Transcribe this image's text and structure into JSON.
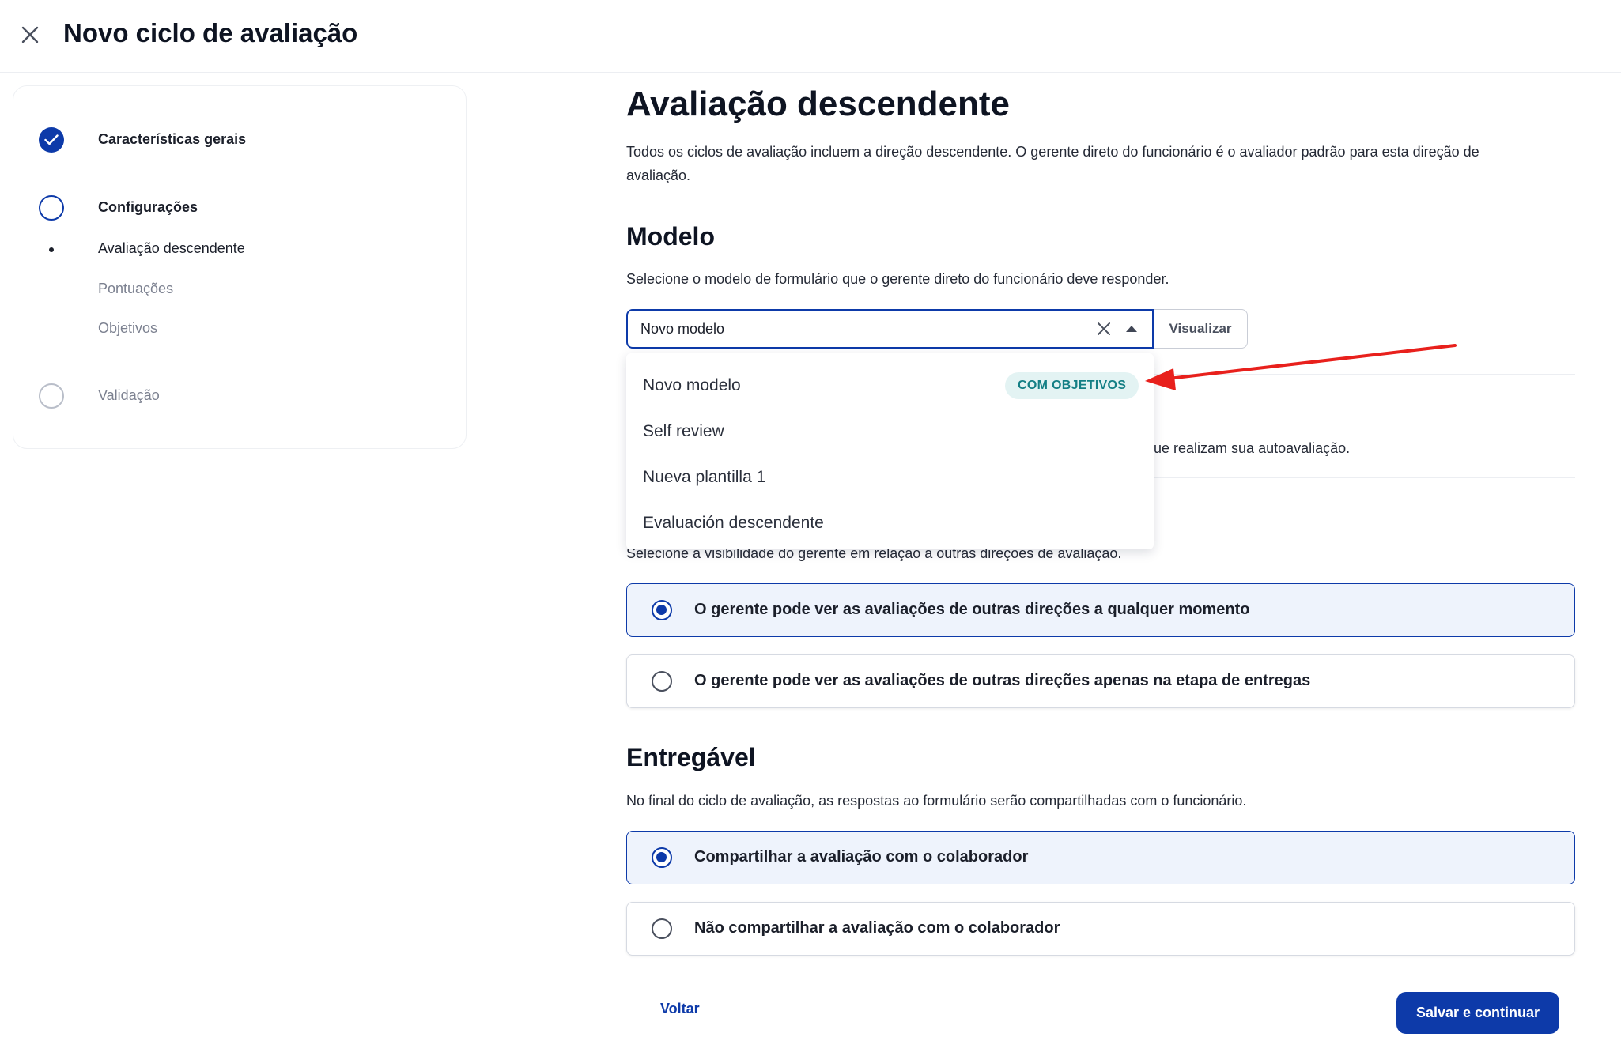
{
  "header": {
    "title": "Novo ciclo de avaliação",
    "close_icon": "close-icon"
  },
  "stepper": {
    "steps": [
      {
        "label": "Características gerais",
        "status": "done"
      },
      {
        "label": "Configurações",
        "status": "current"
      },
      {
        "label": "Avaliação descendente",
        "status": "sub-current"
      },
      {
        "label": "Pontuações",
        "status": "sub-pending"
      },
      {
        "label": "Objetivos",
        "status": "sub-pending"
      },
      {
        "label": "Validação",
        "status": "pending"
      }
    ]
  },
  "main": {
    "title": "Avaliação descendente",
    "description": "Todos os ciclos de avaliação incluem a direção descendente. O gerente direto do funcionário é o avaliador padrão para esta direção de avaliação.",
    "modelo": {
      "heading": "Modelo",
      "description": "Selecione o modelo de formulário que o gerente direto do funcionário deve responder.",
      "select_value": "Novo modelo",
      "view_button": "Visualizar",
      "options": [
        {
          "label": "Novo modelo",
          "badge": "COM OBJETIVOS"
        },
        {
          "label": "Self review",
          "badge": ""
        },
        {
          "label": "Nueva plantilla 1",
          "badge": ""
        },
        {
          "label": "Evaluación descendente",
          "badge": ""
        }
      ]
    },
    "obscured_text_1": "ue realizam sua autoavaliação.",
    "visibility": {
      "description": "Selecione a visibilidade do gerente em relação a outras direções de avaliação.",
      "options": [
        {
          "label": "O gerente pode ver as avaliações de outras direções a qualquer momento",
          "selected": true
        },
        {
          "label": "O gerente pode ver as avaliações de outras direções apenas na etapa de entregas",
          "selected": false
        }
      ]
    },
    "entregavel": {
      "heading": "Entregável",
      "description": "No final do ciclo de avaliação, as respostas ao formulário serão compartilhadas com o funcionário.",
      "options": [
        {
          "label": "Compartilhar a avaliação com o colaborador",
          "selected": true
        },
        {
          "label": "Não compartilhar a avaliação com o colaborador",
          "selected": false
        }
      ]
    }
  },
  "footer": {
    "back_label": "Voltar",
    "save_label": "Salvar e continuar"
  },
  "colors": {
    "primary": "#0d3aa9",
    "badge_bg": "#e3f3f3",
    "badge_text": "#147f85",
    "annotation_arrow": "#e8201c"
  }
}
